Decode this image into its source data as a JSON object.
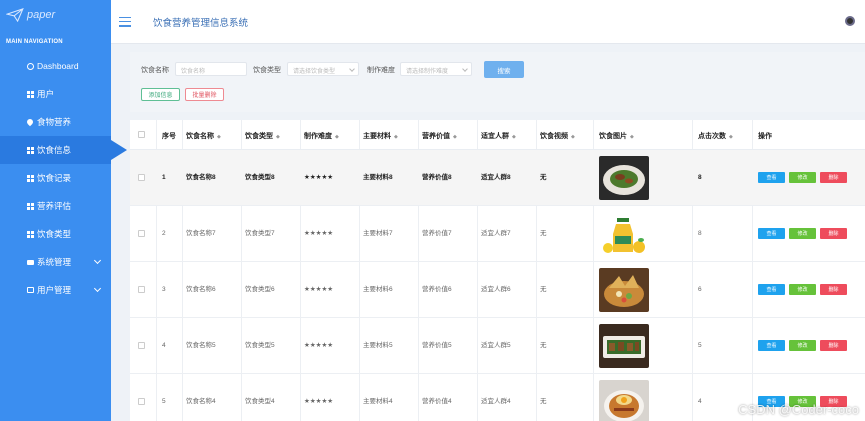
{
  "sidebar": {
    "brand": "paper",
    "nav_header": "MAIN NAVIGATION",
    "items": [
      {
        "label": "Dashboard"
      },
      {
        "label": "用户"
      },
      {
        "label": "食物营养"
      },
      {
        "label": "饮食信息"
      },
      {
        "label": "饮食记录"
      },
      {
        "label": "营养评估"
      },
      {
        "label": "饮食类型"
      },
      {
        "label": "系统管理"
      },
      {
        "label": "用户管理"
      }
    ]
  },
  "header": {
    "title": "饮食营养管理信息系统"
  },
  "search": {
    "name_label": "饮食名称",
    "name_placeholder": "饮食名称",
    "type_label": "饮食类型",
    "type_placeholder": "请选择饮食类型",
    "difficulty_label": "制作难度",
    "difficulty_placeholder": "请选择制作难度",
    "search_button": "搜索",
    "add_button": "添加信息",
    "delete_button": "批量删除"
  },
  "table": {
    "columns": [
      "序号",
      "饮食名称",
      "饮食类型",
      "制作难度",
      "主要材料",
      "营养价值",
      "适宜人群",
      "饮食视频",
      "饮食图片",
      "点击次数",
      "操作"
    ],
    "rows": [
      {
        "no": "1",
        "name": "饮食名称8",
        "type": "饮食类型8",
        "difficulty": "★★★★★",
        "material": "主要材料8",
        "value": "营养价值8",
        "crowd": "适宜人群8",
        "video": "无",
        "clicks": "8"
      },
      {
        "no": "2",
        "name": "饮食名称7",
        "type": "饮食类型7",
        "difficulty": "★★★★★",
        "material": "主要材料7",
        "value": "营养价值7",
        "crowd": "适宜人群7",
        "video": "无",
        "clicks": "8"
      },
      {
        "no": "3",
        "name": "饮食名称6",
        "type": "饮食类型6",
        "difficulty": "★★★★★",
        "material": "主要材料6",
        "value": "营养价值6",
        "crowd": "适宜人群6",
        "video": "无",
        "clicks": "6"
      },
      {
        "no": "4",
        "name": "饮食名称5",
        "type": "饮食类型5",
        "difficulty": "★★★★★",
        "material": "主要材料5",
        "value": "营养价值5",
        "crowd": "适宜人群5",
        "video": "无",
        "clicks": "5"
      },
      {
        "no": "5",
        "name": "饮食名称4",
        "type": "饮食类型4",
        "difficulty": "★★★★★",
        "material": "主要材料4",
        "value": "营养价值4",
        "crowd": "适宜人群4",
        "video": "无",
        "clicks": "4"
      }
    ],
    "actions": {
      "view": "查看",
      "edit": "修改",
      "delete": "删除"
    }
  },
  "watermark": "CSDN @Coder-coco",
  "colors": {
    "sidebar": "#3b8ef0",
    "active": "#2a7ae0",
    "view": "#1ea2ee",
    "edit": "#66c23a",
    "delete": "#ee4c5c"
  }
}
